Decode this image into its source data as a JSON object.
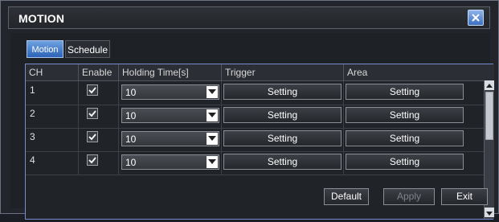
{
  "window": {
    "title": "MOTION"
  },
  "tabs": [
    {
      "label": "Motion",
      "active": true
    },
    {
      "label": "Schedule",
      "active": false
    }
  ],
  "table": {
    "columns": [
      "CH",
      "Enable",
      "Holding Time[s]",
      "Trigger",
      "Area"
    ],
    "rows": [
      {
        "ch": "1",
        "enabled": true,
        "holding_time": "10",
        "trigger": "Setting",
        "area": "Setting"
      },
      {
        "ch": "2",
        "enabled": true,
        "holding_time": "10",
        "trigger": "Setting",
        "area": "Setting"
      },
      {
        "ch": "3",
        "enabled": true,
        "holding_time": "10",
        "trigger": "Setting",
        "area": "Setting"
      },
      {
        "ch": "4",
        "enabled": true,
        "holding_time": "10",
        "trigger": "Setting",
        "area": "Setting"
      }
    ]
  },
  "footer": {
    "default_label": "Default",
    "apply_label": "Apply",
    "exit_label": "Exit"
  },
  "colors": {
    "accent": "#3d6fc4",
    "background": "#1e2126",
    "text": "#ffffff",
    "disabled_text": "#7e838b"
  }
}
